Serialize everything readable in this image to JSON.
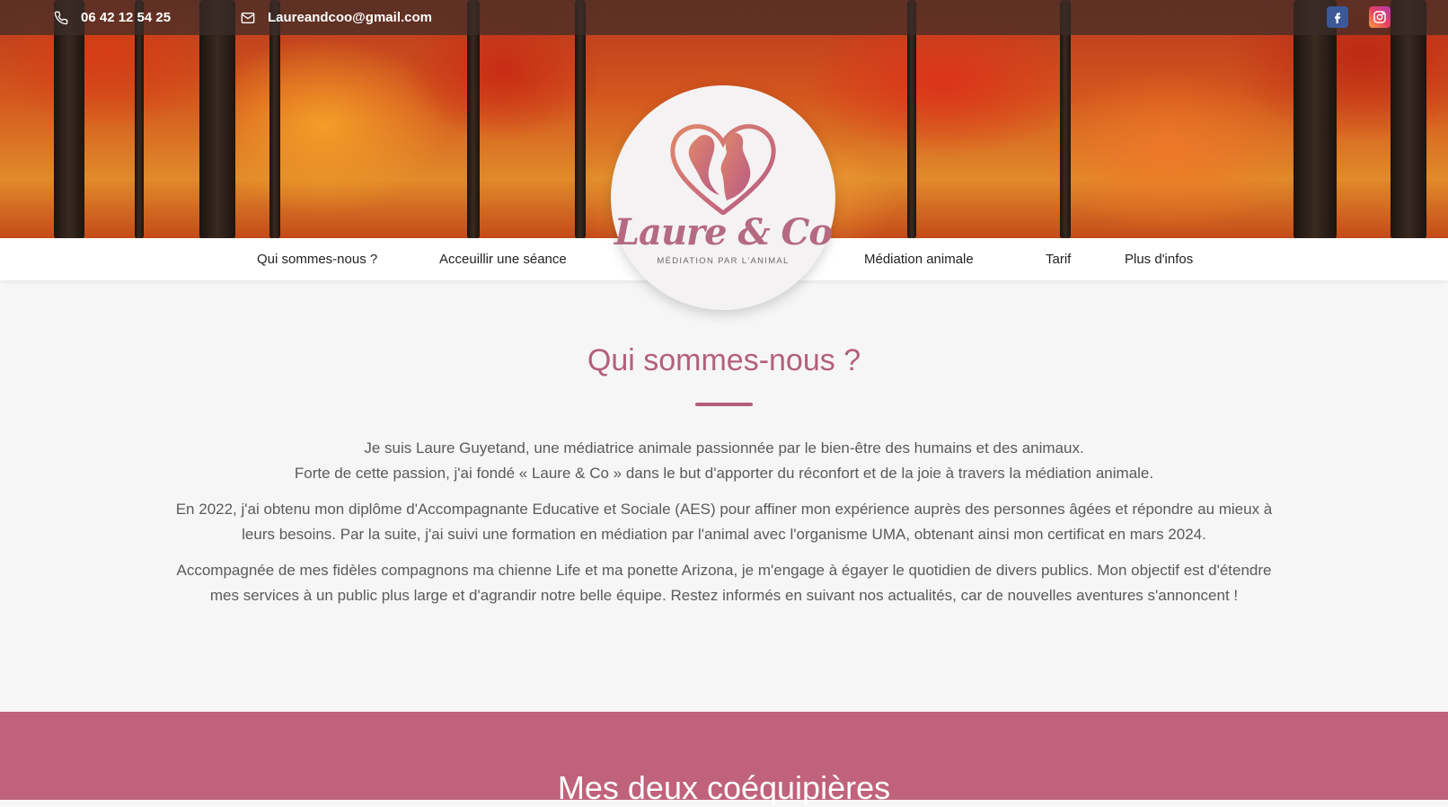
{
  "topbar": {
    "phone": "06 42 12 54 25",
    "email": "Laureandcoo@gmail.com",
    "phone_icon": "phone-icon",
    "email_icon": "mail-icon",
    "social": [
      {
        "name": "facebook-icon",
        "color": "#3b5998"
      },
      {
        "name": "instagram-icon",
        "color": "#e4405f"
      }
    ]
  },
  "nav": {
    "items": [
      {
        "label": "Qui sommes-nous ?"
      },
      {
        "label": "Acceuillir une séance"
      },
      {
        "label": "Médiation animale"
      },
      {
        "label": "Tarif"
      },
      {
        "label": "Plus d'infos"
      }
    ]
  },
  "logo": {
    "title": "Laure & Co",
    "subtitle": "MÉDIATION PAR L'ANIMAL"
  },
  "about": {
    "title": "Qui sommes-nous ?",
    "paragraphs": [
      "Je suis Laure Guyetand, une médiatrice animale passionnée par le bien-être des humains et des animaux.",
      "Forte de cette passion, j'ai fondé « Laure & Co » dans le but d'apporter du réconfort et de la joie à travers la médiation animale.",
      "En 2022, j'ai obtenu mon diplôme d'Accompagnante Educative et Sociale (AES) pour affiner mon expérience auprès des personnes âgées et répondre au mieux à leurs besoins. Par la suite, j'ai suivi une formation en médiation par l'animal avec l'organisme UMA, obtenant ainsi mon certificat en mars 2024.",
      "Accompagnée de mes fidèles compagnons ma chienne Life et ma ponette Arizona, je m'engage à égayer le quotidien de divers publics. Mon objectif est d'étendre mes services à un public plus large et d'agrandir notre belle équipe. Restez informés en suivant nos actualités, car de nouvelles aventures s'annoncent !"
    ]
  },
  "team": {
    "title": "Mes deux coéquipières"
  },
  "colors": {
    "accent": "#b4607a",
    "band": "#c0627b"
  }
}
